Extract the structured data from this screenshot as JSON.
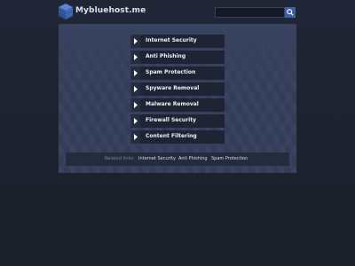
{
  "header": {
    "site_title": "Mybluehost.me",
    "logo_icon": "stacked-cube-logo",
    "search": {
      "placeholder": "",
      "value": "",
      "button_icon": "search-icon"
    }
  },
  "menu": {
    "items": [
      {
        "label": "Internet Security"
      },
      {
        "label": "Anti Phishing"
      },
      {
        "label": "Spam Protection"
      },
      {
        "label": "Spyware Removal"
      },
      {
        "label": "Malware Removal"
      },
      {
        "label": "Firewall Security"
      },
      {
        "label": "Content Filtering"
      }
    ],
    "item_icon": "chevron-right-icon"
  },
  "related": {
    "label": "Related links:",
    "links": [
      {
        "label": "Internet Security"
      },
      {
        "label": "Anti Phishing"
      },
      {
        "label": "Spam Protection"
      }
    ]
  },
  "colors": {
    "background": "#1d2230",
    "panel": "#2e3650",
    "menu_item": "#1e2434",
    "accent": "#3c62a4"
  }
}
